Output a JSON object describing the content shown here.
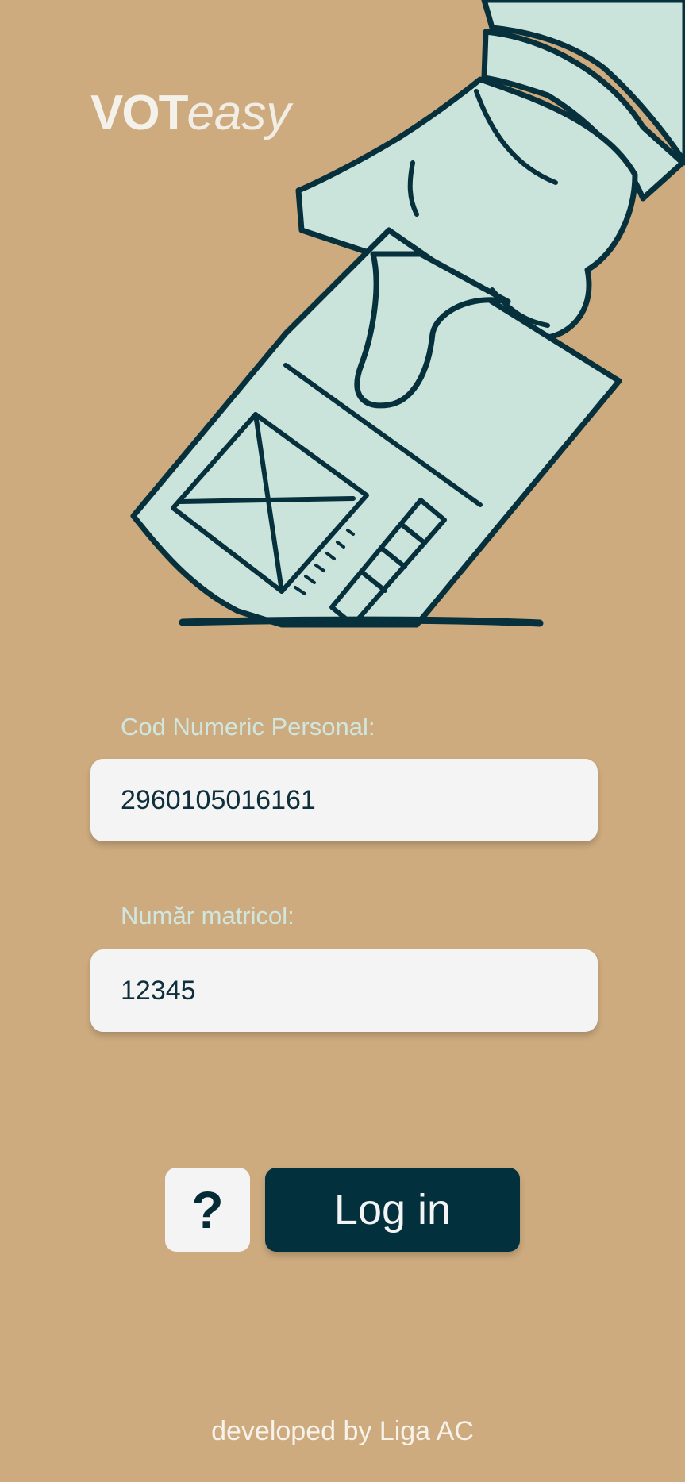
{
  "app": {
    "logo_bold": "VOT",
    "logo_light": "easy"
  },
  "form": {
    "cnp_label": "Cod Numeric Personal:",
    "cnp_value": "2960105016161",
    "matricol_label": "Număr matricol:",
    "matricol_value": "12345"
  },
  "actions": {
    "help_label": "?",
    "login_label": "Log in"
  },
  "footer": {
    "text": "developed by Liga AC"
  },
  "icons": {
    "illustration": "hand-casting-ballot-illustration"
  },
  "colors": {
    "background": "#cdab7f",
    "accent_dark": "#02303d",
    "ballot_fill": "#cae4dc",
    "input_bg": "#f4f4f4"
  }
}
